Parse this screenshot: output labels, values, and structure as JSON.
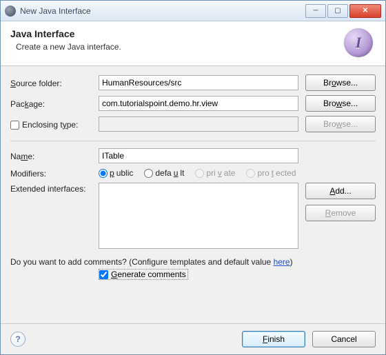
{
  "window": {
    "title": "New Java Interface"
  },
  "banner": {
    "heading": "Java Interface",
    "subtitle": "Create a new Java interface.",
    "icon_letter": "I"
  },
  "labels": {
    "source_folder": "Source folder:",
    "package": "Package:",
    "enclosing_type": "Enclosing type:",
    "name": "Name:",
    "modifiers": "Modifiers:",
    "extended_interfaces": "Extended interfaces:"
  },
  "fields": {
    "source_folder": "HumanResources/src",
    "package": "com.tutorialspoint.demo.hr.view",
    "enclosing_type": "",
    "name": "ITable"
  },
  "modifiers": {
    "public": "public",
    "default": "default",
    "private": "private",
    "protected": "protected",
    "selected": "public"
  },
  "buttons": {
    "browse": "Browse...",
    "add": "Add...",
    "remove": "Remove",
    "finish": "Finish",
    "cancel": "Cancel"
  },
  "comments": {
    "question_prefix": "Do you want to add comments? (Configure templates and default value ",
    "link": "here",
    "question_suffix": ")",
    "generate_label": "Generate comments",
    "generate_checked": true
  },
  "enclosing_checked": false
}
